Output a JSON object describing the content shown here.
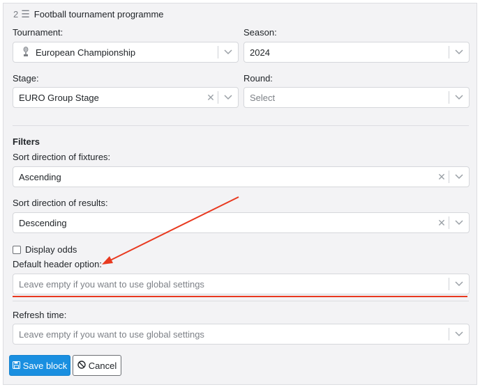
{
  "header": {
    "number": "2",
    "title": "Football tournament programme"
  },
  "tournament": {
    "label": "Tournament:",
    "value": "European Championship"
  },
  "season": {
    "label": "Season:",
    "value": "2024"
  },
  "stage": {
    "label": "Stage:",
    "value": "EURO Group Stage"
  },
  "round": {
    "label": "Round:",
    "placeholder": "Select"
  },
  "filters": {
    "heading": "Filters",
    "fixtures_label": "Sort direction of fixtures:",
    "fixtures_value": "Ascending",
    "results_label": "Sort direction of results:",
    "results_value": "Descending",
    "display_odds_label": "Display odds",
    "header_option_label": "Default header option:",
    "header_option_placeholder": "Leave empty if you want to use global settings",
    "refresh_label": "Refresh time:",
    "refresh_placeholder": "Leave empty if you want to use global settings"
  },
  "buttons": {
    "save": "Save block",
    "cancel": "Cancel"
  },
  "colors": {
    "primary": "#1a8fe0",
    "annotation": "#e8391f"
  }
}
